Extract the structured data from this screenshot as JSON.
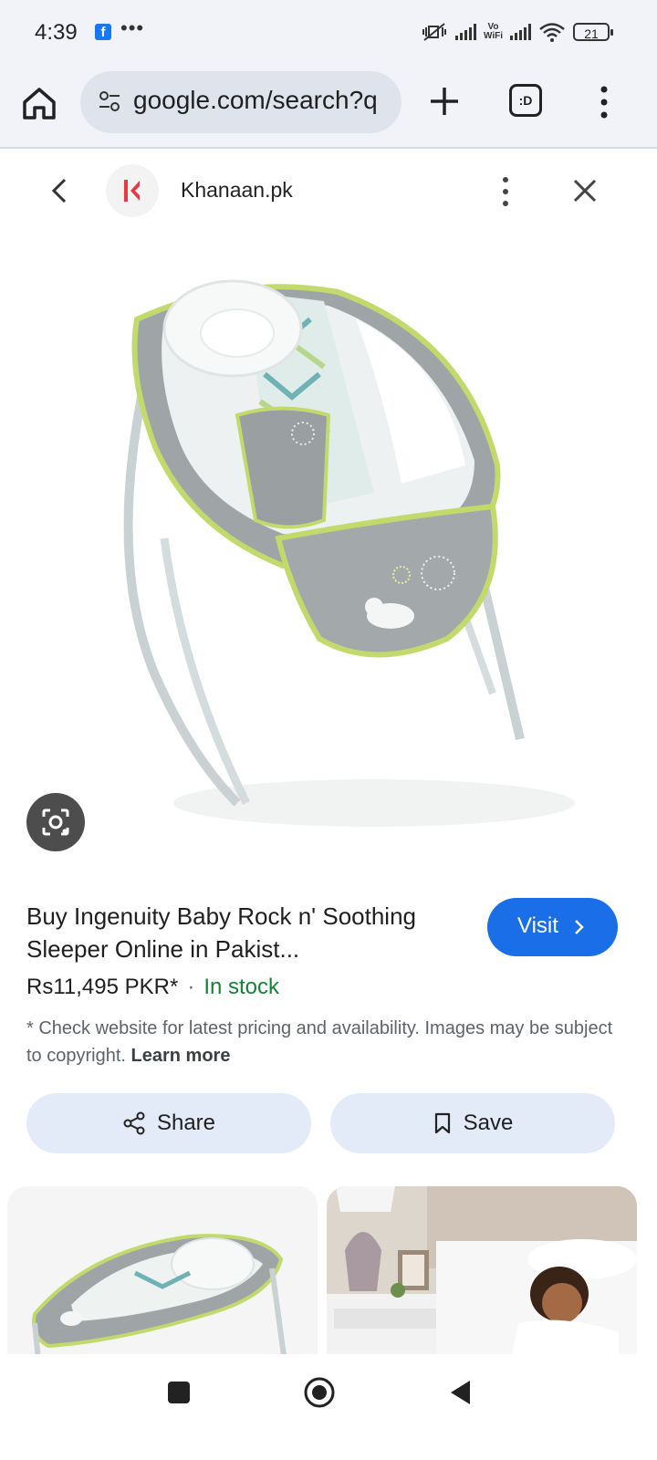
{
  "status_bar": {
    "time": "4:39",
    "notification_icon": "facebook-icon",
    "more": "•••",
    "vowifi_top": "Vo",
    "vowifi_bottom": "WiFi",
    "battery": "21"
  },
  "toolbar": {
    "url": "google.com/search?q",
    "tabs_label": ":D"
  },
  "result": {
    "site_name": "Khanaan.pk",
    "title": "Buy Ingenuity Baby Rock n' Soothing Sleeper Online in Pakist...",
    "visit_label": "Visit",
    "price": "Rs11,495 PKR*",
    "separator": "·",
    "stock": "In stock",
    "disclaimer": "* Check website for latest pricing and availability. Images may be subject to copyright.",
    "learn_more": "Learn more",
    "share_label": "Share",
    "save_label": "Save"
  },
  "colors": {
    "accent": "#1a6fe8",
    "stock_green": "#188038",
    "pill_bg": "#e3ebf9"
  }
}
